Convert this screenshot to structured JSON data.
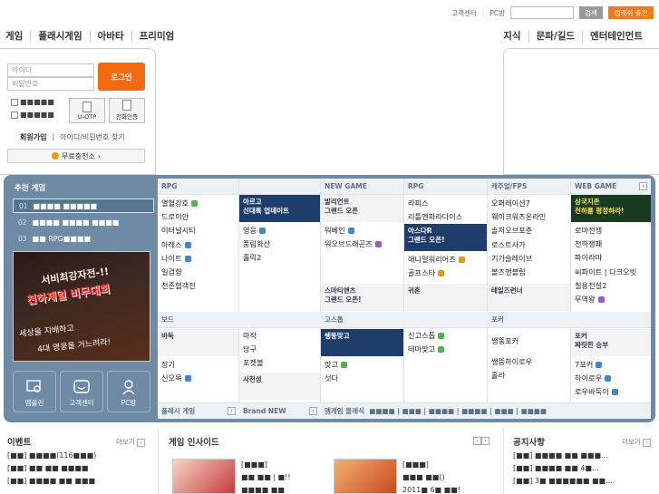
{
  "utility": {
    "customer_center": "고객센터",
    "pc_room": "PC방",
    "search_button": "검색",
    "charge_button": "캡캐쉬 충전"
  },
  "nav_left": [
    "게임",
    "플래시게임",
    "아바타",
    "프리미엄"
  ],
  "nav_right": [
    "지식",
    "문파/길드",
    "엔터테인먼트"
  ],
  "login": {
    "id_placeholder": "아이디",
    "pw_placeholder": "비밀번호",
    "login_button": "로그인",
    "check1": "■■■■■",
    "check2": "■■■■■",
    "uotp": "U-OTP",
    "phone_auth": "전화인증",
    "signup": "회원가입",
    "find": "아이디/비밀번호 찾기",
    "charge": "무료충전소"
  },
  "reco": {
    "title": "추천 게임",
    "items": [
      {
        "num": "01",
        "label": "■■■■.■■■■■"
      },
      {
        "num": "02",
        "label": "■■■■ ■■■■ ■■■■"
      },
      {
        "num": "03",
        "label": "■■ RPG■■■■"
      }
    ],
    "banner_t1": "서비최강자전-!!",
    "banner_t2": "천하제일 비무대회",
    "banner_t3": "세상을 지배하고",
    "banner_t4": "4대 영웅을 거느려라!",
    "quick": [
      "엠플린",
      "고객센터",
      "PC방"
    ]
  },
  "columns": {
    "rpg1": {
      "head": "RPG",
      "items": [
        "열혈강호",
        "드로이얀",
        "이터널시티",
        "아레스",
        "나이트",
        "일검향",
        "천존협객전"
      ],
      "promo": "아르고\n신대륙 업데이트"
    },
    "rpg1b": {
      "items": [
        "영웅",
        "풍림화산",
        "홀릭2"
      ]
    },
    "newgame": {
      "head": "NEW GAME",
      "promo": "발리언트\n그랜드 오픈",
      "items": [
        "워베인",
        "워오브드래곤즈"
      ],
      "promo2": "스마티앤츠\n그랜드 오픈!"
    },
    "rpg2": {
      "head": "RPG",
      "items": [
        "라피스",
        "리틀엔파라다이스"
      ],
      "promo": "아스다R\n그랜드 오픈!",
      "items2": [
        "애니멀워리어즈",
        "골프스타"
      ],
      "promo2": "귀혼"
    },
    "casual": {
      "head": "캐주얼/FPS",
      "items": [
        "오퍼레이션7",
        "웨이크워즈온라인",
        "솔저오브포춘",
        "로스트사가",
        "기가슬레이브",
        "볼츠앤블립"
      ],
      "promo": "테일즈런너"
    },
    "webgame": {
      "head": "WEB GAME",
      "promo": "삼국지존\n천하를 평정하라!",
      "items": [
        "로마전쟁",
        "천하쟁패",
        "파이라마",
        "씨파이트 | 다크오빗",
        "칠용전설2",
        "무역왕"
      ]
    },
    "board": {
      "head": "보드",
      "items": [
        "바둑",
        "장기",
        "신오목"
      ],
      "items2": [
        "마작",
        "당구",
        "포켓볼",
        "사천성"
      ]
    },
    "gostop": {
      "head": "고스톱",
      "promo": "쌩뚱맞고",
      "items": [
        "맞고",
        "섯다"
      ],
      "items2": [
        "신고스톱",
        "테마맞고"
      ]
    },
    "poker": {
      "head": "포커",
      "items": [
        "쌩뚱포커",
        "쌩뚱하이로우",
        "홀라"
      ],
      "promo": "포커\n짜릿한 승부",
      "items2": [
        "7포커",
        "하이로우",
        "로우바둑이"
      ]
    },
    "footer": {
      "flash": "플래시 게임",
      "brand": "Brand NEW",
      "mgame": "엠게임 클래식",
      "mgame_list": "■■■■ | ■■■ | ■■■■ | ■■■■ | ■■■ | ■■■■"
    }
  },
  "bottom": {
    "event_title": "이벤트",
    "event_more": "더보기",
    "event_items": [
      "[■■] ■■■■(116■■■)",
      "[■■] ■■ ■■ ■■■■",
      "[■■] ■■■■ ■■ ■■■"
    ],
    "insight_title": "게임 인사이드",
    "insight_1": [
      "[■■■]",
      "■■ ■■ | ■!!",
      "■■■■ ■■"
    ],
    "insight_2": [
      "[■■■]",
      "■■■ ■■()",
      "2011■ 6■ ■■!"
    ],
    "notice_title": "공지사항",
    "notice_more": "더보기",
    "notice_items": [
      "[■■] ■■■■ ■■ ■■■...",
      "[■■] ■■■■ ■■ 4■...",
      "[■■] 3■ ■■■■■■ ■■..."
    ]
  }
}
